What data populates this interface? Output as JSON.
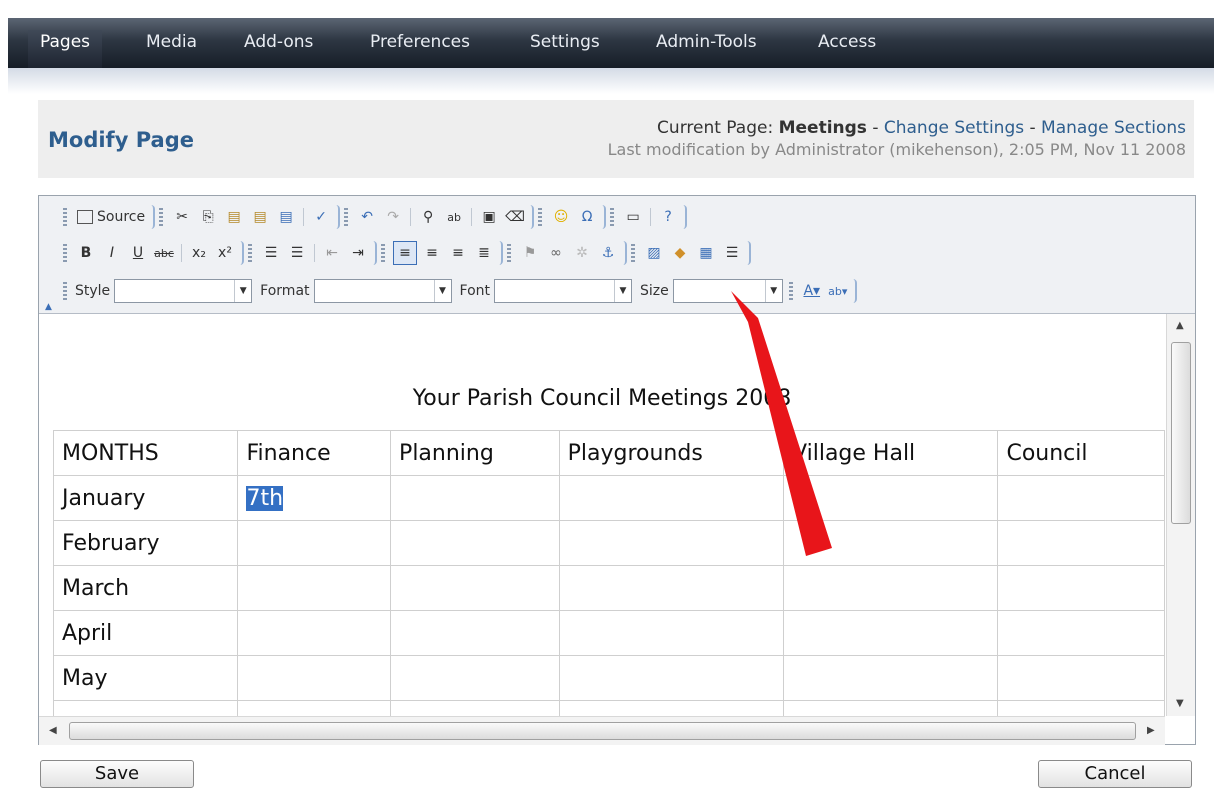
{
  "nav": {
    "items": [
      "Pages",
      "Media",
      "Add-ons",
      "Preferences",
      "Settings",
      "Admin-Tools",
      "Access"
    ]
  },
  "header": {
    "title": "Modify Page",
    "current_page_label": "Current Page:",
    "current_page": "Meetings",
    "separator": "-",
    "change_settings": "Change Settings",
    "manage_sections": "Manage Sections",
    "last_modification": "Last modification by Administrator (mikehenson), 2:05 PM, Nov 11 2008"
  },
  "toolbar": {
    "source_label": "Source",
    "style_label": "Style",
    "format_label": "Format",
    "font_label": "Font",
    "size_label": "Size",
    "style_value": "",
    "format_value": "",
    "font_value": "",
    "size_value": ""
  },
  "document": {
    "title": "Your Parish Council Meetings 2008",
    "headers": [
      "MONTHS",
      "Finance",
      "Planning",
      "Playgrounds",
      "Village Hall",
      "Council"
    ],
    "rows": [
      [
        "January",
        "7th",
        "",
        "",
        "",
        ""
      ],
      [
        "February",
        "",
        "",
        "",
        "",
        ""
      ],
      [
        "March",
        "",
        "",
        "",
        "",
        ""
      ],
      [
        "April",
        "",
        "",
        "",
        "",
        ""
      ],
      [
        "May",
        "",
        "",
        "",
        "",
        ""
      ],
      [
        "",
        "",
        "",
        "",
        "",
        ""
      ]
    ],
    "selected_text": "7th"
  },
  "buttons": {
    "save": "Save",
    "cancel": "Cancel"
  },
  "colors": {
    "nav_dark": "#1d2430",
    "title_blue": "#2e5e8e",
    "selection": "#3470c4",
    "annotation_arrow": "#e8151a"
  }
}
